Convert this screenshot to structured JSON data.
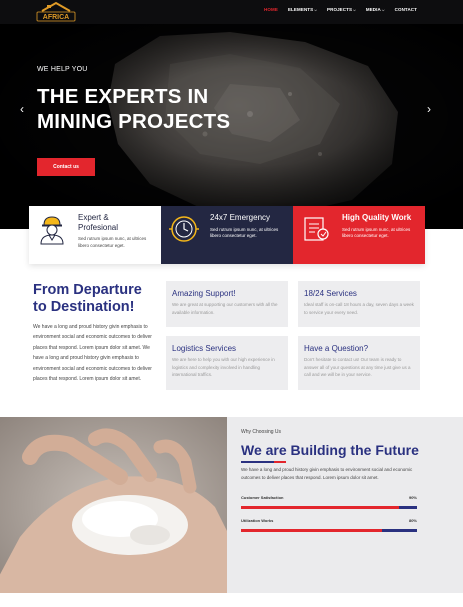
{
  "brand": {
    "logo_text": "AFRICA"
  },
  "nav": {
    "items": [
      {
        "label": "HOME",
        "active": true,
        "dropdown": false
      },
      {
        "label": "ELEMENTS",
        "active": false,
        "dropdown": true
      },
      {
        "label": "PROJECTS",
        "active": false,
        "dropdown": true
      },
      {
        "label": "MEDIA",
        "active": false,
        "dropdown": true
      },
      {
        "label": "CONTACT",
        "active": false,
        "dropdown": false
      }
    ]
  },
  "hero": {
    "eyebrow": "WE HELP YOU",
    "title": "THE EXPERTS IN\nMINING PROJECTS",
    "cta": "Contact us",
    "prev_icon": "chevron-left-icon",
    "next_icon": "chevron-right-icon"
  },
  "features": [
    {
      "title": "Expert &\nProfesional",
      "text": "Sed rutrum ipsum nunc, at ultrices libero consectetur eget.",
      "icon": "worker-icon"
    },
    {
      "title": "24x7 Emergency",
      "text": "Sed rutrum ipsum nunc, at ultrices libero consectetur eget.",
      "icon": "clock-icon"
    },
    {
      "title": "High Quality Work",
      "text": "Sed rutrum ipsum nunc, at ultrices libero consectetur eget.",
      "icon": "quality-icon"
    }
  ],
  "about": {
    "title": "From Departure\nto Destination!",
    "text": "We have a long and proud history givin emphasis to environment social and economic outcomes to deliver places that respond. Lorem ipsum dolor sit amet. We have a long and proud history givin emphasis to environment social and economic outcomes to deliver places that respond. Lorem ipsum dolor sit amet."
  },
  "services": [
    {
      "title": "Amazing Support!",
      "text": "We are great at supporting our customers with all the available information."
    },
    {
      "title": "18/24 Services",
      "text": "Ideal staff is on-call 18 hours a day, seven days a week to service your every need."
    },
    {
      "title": "Logistics Services",
      "text": "We are here to help you with our high experience in logistics and complexity involved in handling international traffics."
    },
    {
      "title": "Have a Question?",
      "text": "Don't hesitate to contact us! Our team is ready to answer all of your questions at any time just give us a call and we will be in your service."
    }
  ],
  "why": {
    "eyebrow": "Why Choosing Us",
    "title": "We are Building the Future",
    "text": "We have a long and proud history givin emphasis to environment social and economic outcomes to deliver places that respond. Lorem ipsum dolor sit amet.",
    "skills": [
      {
        "label": "Customer Satisfaction",
        "percent": "90%",
        "value": 0.9
      },
      {
        "label": "Utilization Works",
        "percent": "80%",
        "value": 0.8
      }
    ]
  },
  "colors": {
    "accent_red": "#e3262d",
    "navy": "#2a3180",
    "dark_card": "#232742"
  }
}
